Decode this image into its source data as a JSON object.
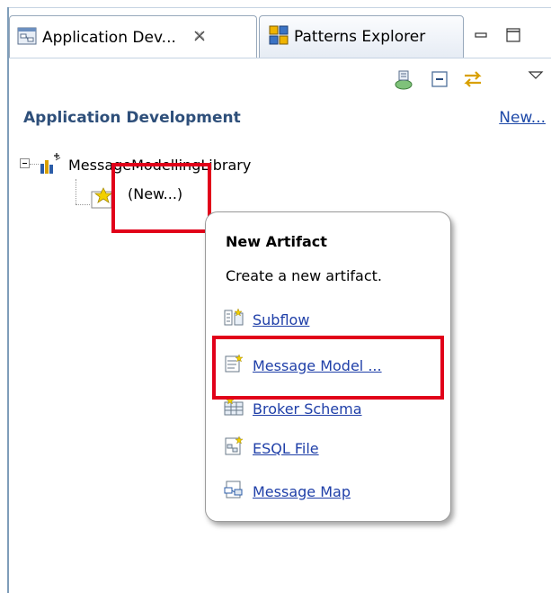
{
  "tabs": [
    {
      "label": "Application Dev...",
      "active": true,
      "icon": "application-development-icon",
      "close_glyph": "✕"
    },
    {
      "label": "Patterns Explorer",
      "active": false,
      "icon": "patterns-explorer-icon"
    }
  ],
  "window_controls": [
    "minimize-icon",
    "maximize-icon"
  ],
  "toolbar": [
    "link-with-editor-icon",
    "collapse-all-icon",
    "sync-icon",
    "view-menu-icon"
  ],
  "view": {
    "title": "Application Development",
    "new_link": "New..."
  },
  "tree": {
    "root": {
      "label": "MessageModellingLibrary",
      "icon": "library-icon",
      "expanded": true
    },
    "child": {
      "label": "(New...)",
      "icon": "new-artifact-icon"
    }
  },
  "popup": {
    "title": "New Artifact",
    "description": "Create a new artifact.",
    "items": [
      {
        "label": "Subflow",
        "icon": "subflow-icon"
      },
      {
        "label": "Message Model ...",
        "icon": "message-model-icon"
      },
      {
        "label": "Broker Schema",
        "icon": "broker-schema-icon"
      },
      {
        "label": "ESQL File",
        "icon": "esql-file-icon"
      },
      {
        "label": "Message Map",
        "icon": "message-map-icon"
      }
    ]
  },
  "colors": {
    "highlight": "#e1001a",
    "link": "#1f3fa8",
    "title": "#2e4f7a",
    "border": "#97a8bb"
  }
}
